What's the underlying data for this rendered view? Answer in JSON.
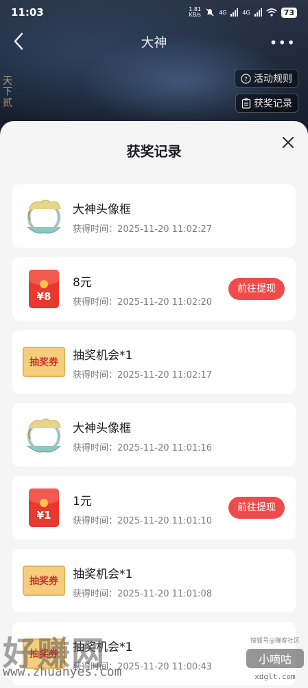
{
  "status_bar": {
    "time": "11:03",
    "net_speed": "1.81",
    "net_unit": "KB/s",
    "sig1": "4G",
    "sig2": "4G",
    "battery": "73"
  },
  "nav": {
    "title": "大神"
  },
  "buttons": {
    "rules": "活动规则",
    "records": "获奖记录"
  },
  "sheet": {
    "title": "获奖记录"
  },
  "records": [
    {
      "name": "大神头像框",
      "time": "获得时间：2025-11-20 11:02:27",
      "thumb": "avatar-frame-icon",
      "action": ""
    },
    {
      "name": "8元",
      "time": "获得时间：2025-11-20 11:02:20",
      "thumb": "red-packet-icon",
      "amount": "¥8",
      "action": "前往提现"
    },
    {
      "name": "抽奖机会*1",
      "time": "获得时间：2025-11-20 11:02:17",
      "thumb": "lottery-ticket-icon",
      "ticket": "抽奖券",
      "action": ""
    },
    {
      "name": "大神头像框",
      "time": "获得时间：2025-11-20 11:01:16",
      "thumb": "avatar-frame-icon",
      "action": ""
    },
    {
      "name": "1元",
      "time": "获得时间：2025-11-20 11:01:10",
      "thumb": "red-packet-icon",
      "amount": "¥1",
      "action": "前往提现"
    },
    {
      "name": "抽奖机会*1",
      "time": "获得时间：2025-11-20 11:01:08",
      "thumb": "lottery-ticket-icon",
      "ticket": "抽奖券",
      "action": ""
    },
    {
      "name": "抽奖机会*1",
      "time": "获得时间：2025-11-20 11:00:43",
      "thumb": "lottery-ticket-icon",
      "ticket": "抽奖券",
      "action": ""
    }
  ],
  "watermark": {
    "main": "好赚网",
    "url": "www.zhuanyes.com",
    "right_top": "搜狐号@赚客社区",
    "right_mid": "小嘀咕",
    "right_bot": "xdglt.com"
  },
  "colors": {
    "accent": "#f04b4b",
    "sheet_bg": "#f5f5f6"
  }
}
